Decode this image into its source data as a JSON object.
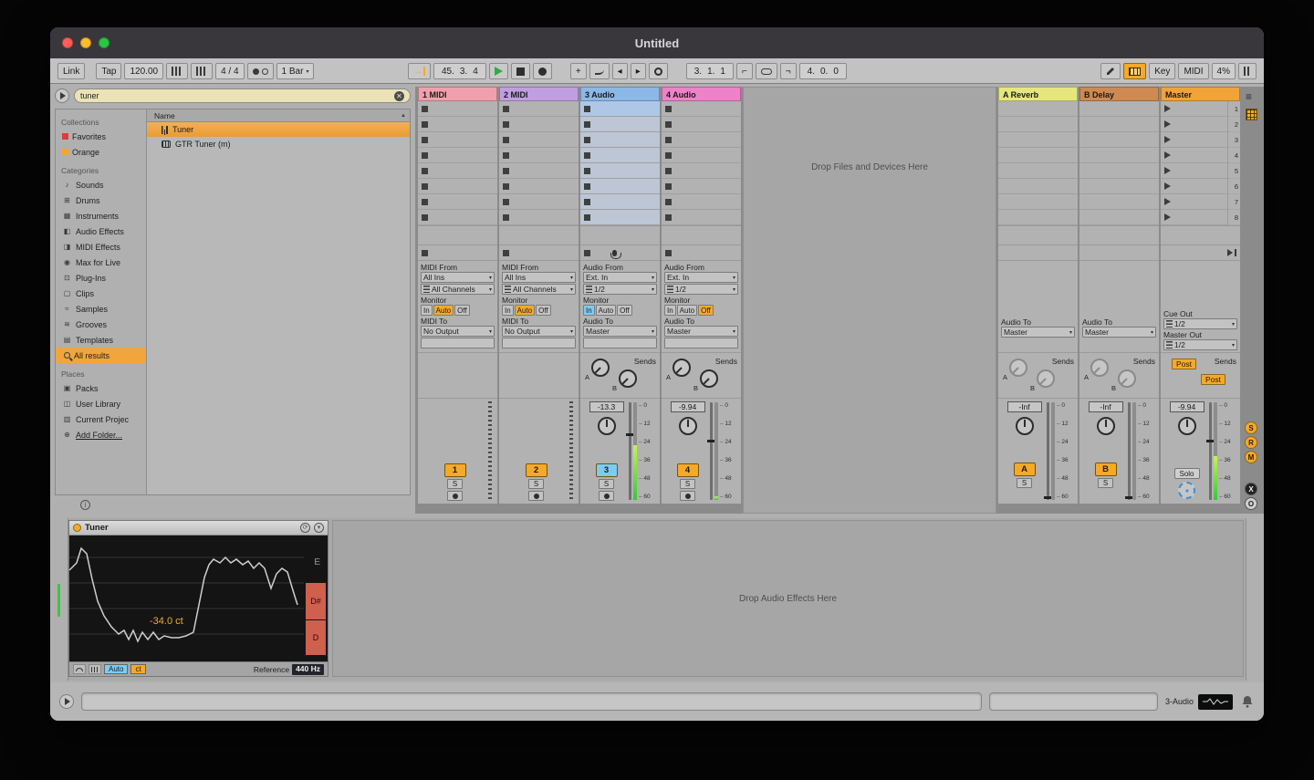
{
  "window": {
    "title": "Untitled"
  },
  "toolbar": {
    "link": "Link",
    "tap": "Tap",
    "tempo": "120.00",
    "time_sig": "4 / 4",
    "quantize": "1 Bar",
    "pos_bars": "45.",
    "pos_beats": "3.",
    "pos_six": "4",
    "loop_start_bars": "3.",
    "loop_start_beats": "1.",
    "loop_start_six": "1",
    "loop_len_bars": "4.",
    "loop_len_beats": "0.",
    "loop_len_six": "0",
    "key": "Key",
    "midi": "MIDI",
    "cpu": "4%"
  },
  "browser": {
    "search_value": "tuner",
    "collections_header": "Collections",
    "collections": [
      {
        "label": "Favorites",
        "color": "#e03a3a"
      },
      {
        "label": "Orange",
        "color": "#f5a623"
      }
    ],
    "categories_header": "Categories",
    "categories": [
      {
        "label": "Sounds"
      },
      {
        "label": "Drums"
      },
      {
        "label": "Instruments"
      },
      {
        "label": "Audio Effects"
      },
      {
        "label": "MIDI Effects"
      },
      {
        "label": "Max for Live"
      },
      {
        "label": "Plug-Ins"
      },
      {
        "label": "Clips"
      },
      {
        "label": "Samples"
      },
      {
        "label": "Grooves"
      },
      {
        "label": "Templates"
      },
      {
        "label": "All results"
      }
    ],
    "places_header": "Places",
    "places": [
      {
        "label": "Packs"
      },
      {
        "label": "User Library"
      },
      {
        "label": "Current Projec"
      },
      {
        "label": "Add Folder..."
      }
    ],
    "results_header": "Name",
    "results": [
      {
        "label": "Tuner"
      },
      {
        "label": "GTR Tuner (m)"
      }
    ]
  },
  "session": {
    "drop_text": "Drop Files and Devices Here",
    "scenes": [
      "1",
      "2",
      "3",
      "4",
      "5",
      "6",
      "7",
      "8"
    ],
    "meter_scale": [
      "0",
      "12",
      "24",
      "36",
      "48",
      "60"
    ],
    "io": {
      "midi_from": "MIDI From",
      "audio_from": "Audio From",
      "all_ins": "All Ins",
      "all_channels": "All Channels",
      "ext_in": "Ext. In",
      "ch12": "1/2",
      "monitor": "Monitor",
      "mon_in": "In",
      "mon_auto": "Auto",
      "mon_off": "Off",
      "midi_to": "MIDI To",
      "audio_to": "Audio To",
      "no_output": "No Output",
      "master": "Master",
      "cue_out": "Cue Out",
      "master_out": "Master Out",
      "sends": "Sends",
      "send_a": "A",
      "send_b": "B",
      "post": "Post",
      "solo": "Solo",
      "s": "S"
    },
    "tracks": [
      {
        "name": "1 MIDI",
        "color": "#f0a0ac",
        "num": "1",
        "num_color": "#f5a928"
      },
      {
        "name": "2 MIDI",
        "color": "#c09ee0",
        "num": "2",
        "num_color": "#f5a928"
      },
      {
        "name": "3 Audio",
        "color": "#8cb8e8",
        "num": "3",
        "num_color": "#7cccf2",
        "vol": "-13.3"
      },
      {
        "name": "4 Audio",
        "color": "#ee82c8",
        "num": "4",
        "num_color": "#f5a928",
        "vol": "-9.94"
      }
    ],
    "returns": [
      {
        "name": "A Reverb",
        "color": "#e5e77d",
        "num": "A",
        "num_color": "#f5a928",
        "vol": "-Inf"
      },
      {
        "name": "B Delay",
        "color": "#cd8a52",
        "num": "B",
        "num_color": "#f5a928",
        "vol": "-Inf"
      }
    ],
    "master": {
      "name": "Master",
      "color": "#f0a339",
      "vol": "-9.94",
      "cue_ch": "1/2",
      "out_ch": "1/2"
    },
    "view_toggles": [
      "S",
      "R",
      "M"
    ],
    "xfade_toggle": "X",
    "io_toggle": "O"
  },
  "device": {
    "title": "Tuner",
    "cents": "-34.0 ct",
    "note_top": "E",
    "note_mid": "D#",
    "note_low": "D",
    "auto": "Auto",
    "ct": "ct",
    "reference_label": "Reference",
    "reference_value": "440 Hz",
    "accent": "#f5a623"
  },
  "device_drop_text": "Drop Audio Effects Here",
  "status": {
    "track_indicator": "3-Audio"
  }
}
